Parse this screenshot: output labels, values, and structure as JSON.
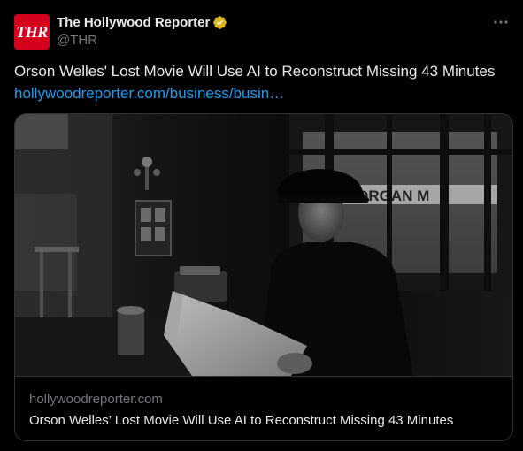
{
  "author": {
    "avatar_text": "THR",
    "display_name": "The Hollywood Reporter",
    "handle": "@THR",
    "verified_icon": "verified-badge-gold-icon"
  },
  "tweet": {
    "text": "Orson Welles' Lost Movie Will Use AI to Reconstruct Missing 43 Minutes",
    "link": "hollywoodreporter.com/business/busin…"
  },
  "card": {
    "image_sign_text": "MORGAN M",
    "domain": "hollywoodreporter.com",
    "title": "Orson Welles’ Lost Movie Will Use AI to Reconstruct Missing 43 Minutes"
  },
  "colors": {
    "background": "#000000",
    "text_primary": "#e7e9ea",
    "text_secondary": "#71767b",
    "link": "#1d9bf0",
    "avatar_brand": "#d6001c",
    "verified_gold": "#e2b719",
    "border": "#2f3336"
  },
  "icons": {
    "more": "more-horizontal-icon"
  }
}
